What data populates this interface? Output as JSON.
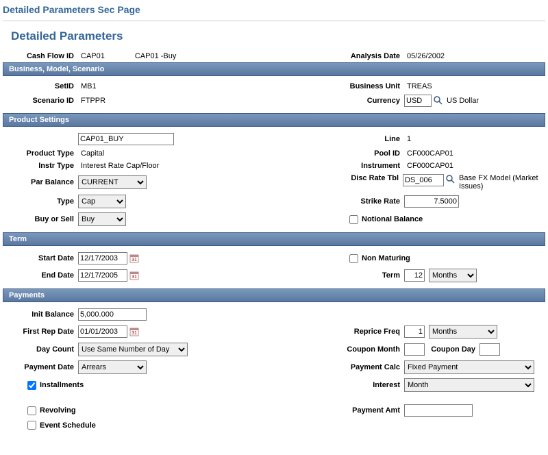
{
  "page": {
    "top_title": "Detailed Parameters Sec Page",
    "title": "Detailed Parameters"
  },
  "header": {
    "cash_flow_id_label": "Cash Flow ID",
    "cash_flow_id": "CAP01",
    "cash_flow_desc": "CAP01 -Buy",
    "analysis_date_label": "Analysis Date",
    "analysis_date": "05/26/2002"
  },
  "sections": {
    "bms_title": "Business, Model, Scenario",
    "product_title": "Product Settings",
    "term_title": "Term",
    "payments_title": "Payments"
  },
  "bms": {
    "setid_label": "SetID",
    "setid": "MB1",
    "scenario_label": "Scenario ID",
    "scenario": "FTPPR",
    "bu_label": "Business Unit",
    "bu": "TREAS",
    "currency_label": "Currency",
    "currency": "USD",
    "currency_desc": "US Dollar"
  },
  "product": {
    "code": "CAP01_BUY",
    "product_type_label": "Product Type",
    "product_type": "Capital",
    "instr_type_label": "Instr Type",
    "instr_type": "Interest Rate Cap/Floor",
    "par_balance_label": "Par Balance",
    "par_balance": "CURRENT",
    "type_label": "Type",
    "type": "Cap",
    "buy_sell_label": "Buy or Sell",
    "buy_sell": "Buy",
    "line_label": "Line",
    "line": "1",
    "pool_id_label": "Pool ID",
    "pool_id": "CF000CAP01",
    "instrument_label": "Instrument",
    "instrument": "CF000CAP01",
    "disc_rate_label": "Disc Rate Tbl",
    "disc_rate": "DS_006",
    "disc_rate_desc": "Base FX Model (Market Issues)",
    "strike_rate_label": "Strike Rate",
    "strike_rate": "7.5000",
    "notional_label": "Notional Balance"
  },
  "term": {
    "start_label": "Start Date",
    "start": "12/17/2003",
    "end_label": "End Date",
    "end": "12/17/2005",
    "non_maturing_label": "Non Maturing",
    "term_label": "Term",
    "term_val": "12",
    "term_unit": "Months"
  },
  "payments": {
    "init_balance_label": "Init Balance",
    "init_balance": "5,000.000",
    "first_rep_label": "First Rep Date",
    "first_rep": "01/01/2003",
    "day_count_label": "Day Count",
    "day_count": "Use Same Number of Day",
    "payment_date_label": "Payment Date",
    "payment_date": "Arrears",
    "installments_label": "Installments",
    "revolving_label": "Revolving",
    "event_schedule_label": "Event Schedule",
    "reprice_freq_label": "Reprice Freq",
    "reprice_freq_val": "1",
    "reprice_freq_unit": "Months",
    "coupon_month_label": "Coupon Month",
    "coupon_day_label": "Coupon Day",
    "payment_calc_label": "Payment Calc",
    "payment_calc": "Fixed Payment",
    "interest_label": "Interest",
    "interest": "Month",
    "payment_amt_label": "Payment Amt"
  }
}
